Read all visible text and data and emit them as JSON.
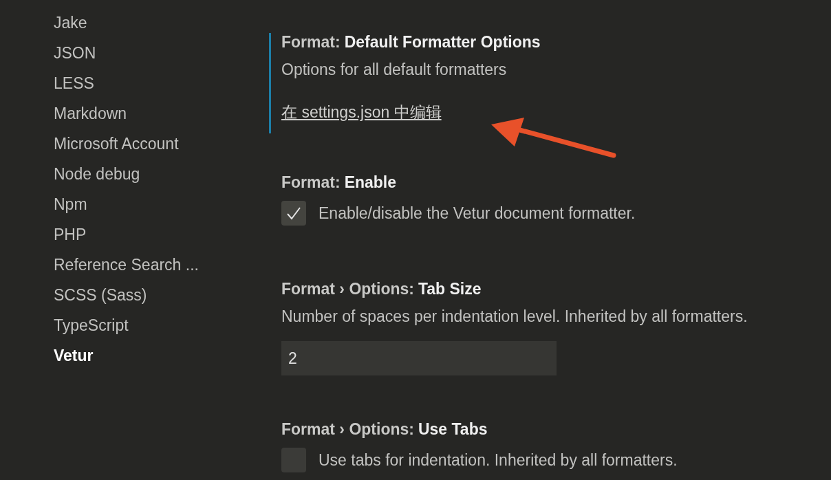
{
  "sidebar": {
    "items": [
      {
        "label": "Jake",
        "selected": false
      },
      {
        "label": "JSON",
        "selected": false
      },
      {
        "label": "LESS",
        "selected": false
      },
      {
        "label": "Markdown",
        "selected": false
      },
      {
        "label": "Microsoft Account",
        "selected": false
      },
      {
        "label": "Node debug",
        "selected": false
      },
      {
        "label": "Npm",
        "selected": false
      },
      {
        "label": "PHP",
        "selected": false
      },
      {
        "label": "Reference Search ...",
        "selected": false
      },
      {
        "label": "SCSS (Sass)",
        "selected": false
      },
      {
        "label": "TypeScript",
        "selected": false
      },
      {
        "label": "Vetur",
        "selected": true
      }
    ]
  },
  "settings": [
    {
      "kind": "link",
      "focused": true,
      "category": "Format:",
      "name": "Default Formatter Options",
      "description": "Options for all default formatters",
      "link": "在 settings.json 中编辑"
    },
    {
      "kind": "checkbox",
      "focused": false,
      "category": "Format:",
      "name": "Enable",
      "checked": true,
      "description": "Enable/disable the Vetur document formatter."
    },
    {
      "kind": "number",
      "focused": false,
      "category": "Format › Options:",
      "name": "Tab Size",
      "description": "Number of spaces per indentation level. Inherited by all formatters.",
      "value": "2"
    },
    {
      "kind": "checkbox",
      "focused": false,
      "category": "Format › Options:",
      "name": "Use Tabs",
      "checked": false,
      "description": "Use tabs for indentation. Inherited by all formatters."
    }
  ]
}
